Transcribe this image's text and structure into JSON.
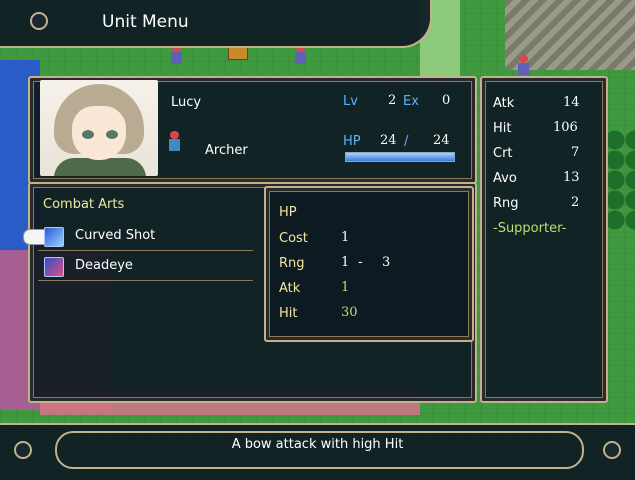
{
  "header": {
    "title": "Unit Menu"
  },
  "unit": {
    "name": "Lucy",
    "class": "Archer",
    "lv_label": "Lv",
    "lv": "2",
    "ex_label": "Ex",
    "ex": "0",
    "hp_label": "HP",
    "hp_current": "24",
    "hp_sep": "/",
    "hp_max": "24",
    "hp_fraction": 1.0
  },
  "combat_arts": {
    "header": "Combat Arts",
    "items": [
      {
        "label": "Curved Shot",
        "icon": "bow-skill-icon",
        "selected": true
      },
      {
        "label": "Deadeye",
        "icon": "eye-skill-icon",
        "selected": false
      }
    ]
  },
  "art_details": {
    "hp_label": "HP",
    "cost_label": "Cost",
    "cost": "1",
    "rng_label": "Rng",
    "rng_min": "1",
    "rng_dash": "-",
    "rng_max": "3",
    "atk_label": "Atk",
    "atk": "1",
    "hit_label": "Hit",
    "hit": "30"
  },
  "stats": {
    "atk_label": "Atk",
    "atk": "14",
    "hit_label": "Hit",
    "hit": "106",
    "crt_label": "Crt",
    "crt": "7",
    "avo_label": "Avo",
    "avo": "13",
    "rng_label": "Rng",
    "rng": "2",
    "role": "-Supporter-"
  },
  "description": "A bow attack with high Hit",
  "colors": {
    "frame_gold": "#c2b28a",
    "label_blue": "#5fb0ff",
    "label_yellow": "#f2e7a0",
    "value_green": "#b7e26c"
  }
}
